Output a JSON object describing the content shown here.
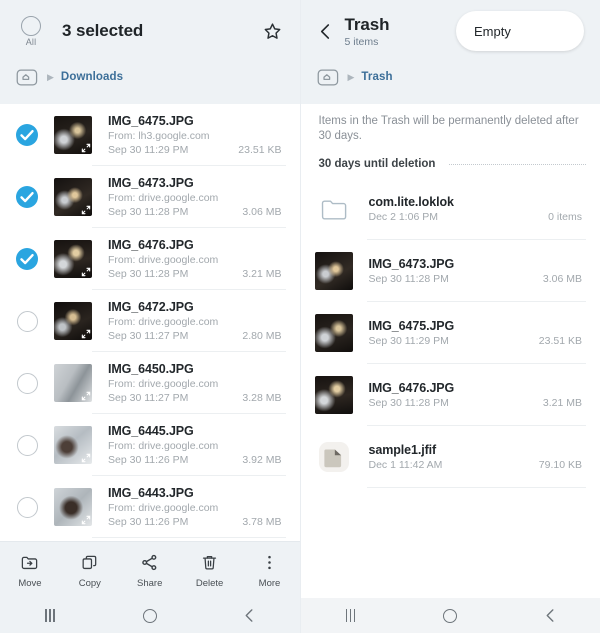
{
  "left": {
    "header": {
      "all_label": "All",
      "title": "3 selected",
      "star_icon": "star-icon",
      "breadcrumb": {
        "home_icon": "home-folder-icon",
        "separator": "▶",
        "current": "Downloads"
      }
    },
    "files": [
      {
        "name": "IMG_6475.JPG",
        "source": "From: lh3.google.com",
        "date": "Sep 30 11:29 PM",
        "size": "23.51 KB",
        "selected": true
      },
      {
        "name": "IMG_6473.JPG",
        "source": "From: drive.google.com",
        "date": "Sep 30 11:28 PM",
        "size": "3.06 MB",
        "selected": true
      },
      {
        "name": "IMG_6476.JPG",
        "source": "From: drive.google.com",
        "date": "Sep 30 11:28 PM",
        "size": "3.21 MB",
        "selected": true
      },
      {
        "name": "IMG_6472.JPG",
        "source": "From: drive.google.com",
        "date": "Sep 30 11:27 PM",
        "size": "2.80 MB",
        "selected": false
      },
      {
        "name": "IMG_6450.JPG",
        "source": "From: drive.google.com",
        "date": "Sep 30 11:27 PM",
        "size": "3.28 MB",
        "selected": false
      },
      {
        "name": "IMG_6445.JPG",
        "source": "From: drive.google.com",
        "date": "Sep 30 11:26 PM",
        "size": "3.92 MB",
        "selected": false
      },
      {
        "name": "IMG_6443.JPG",
        "source": "From: drive.google.com",
        "date": "Sep 30 11:26 PM",
        "size": "3.78 MB",
        "selected": false
      }
    ],
    "toolbar": [
      {
        "label": "Move",
        "icon": "move-to-folder-icon"
      },
      {
        "label": "Copy",
        "icon": "copy-icon"
      },
      {
        "label": "Share",
        "icon": "share-icon"
      },
      {
        "label": "Delete",
        "icon": "trash-icon"
      },
      {
        "label": "More",
        "icon": "more-vertical-icon"
      }
    ]
  },
  "right": {
    "header": {
      "back_icon": "chevron-left-icon",
      "title": "Trash",
      "subtitle": "5 items",
      "empty_button": "Empty",
      "breadcrumb": {
        "home_icon": "home-folder-icon",
        "separator": "▶",
        "current": "Trash"
      }
    },
    "notice": "Items in the Trash will be permanently deleted after 30 days.",
    "section_title": "30 days until deletion",
    "files": [
      {
        "name": "com.lite.loklok",
        "date": "Dec 2 1:06 PM",
        "size": "0 items",
        "kind": "folder"
      },
      {
        "name": "IMG_6473.JPG",
        "date": "Sep 30 11:28 PM",
        "size": "3.06 MB",
        "kind": "photo"
      },
      {
        "name": "IMG_6475.JPG",
        "date": "Sep 30 11:29 PM",
        "size": "23.51 KB",
        "kind": "photo"
      },
      {
        "name": "IMG_6476.JPG",
        "date": "Sep 30 11:28 PM",
        "size": "3.21 MB",
        "kind": "photo"
      },
      {
        "name": "sample1.jfif",
        "date": "Dec 1 11:42 AM",
        "size": "79.10 KB",
        "kind": "file"
      }
    ]
  },
  "navbar": {
    "recents_icon": "recents-icon",
    "home_icon": "home-circle-icon",
    "back_icon": "back-chevron-icon"
  },
  "colors": {
    "header_bg": "#eef2f5",
    "accent_blue": "#2aa5e0",
    "link_blue": "#3c6f99",
    "body_bg": "#ffffff"
  }
}
